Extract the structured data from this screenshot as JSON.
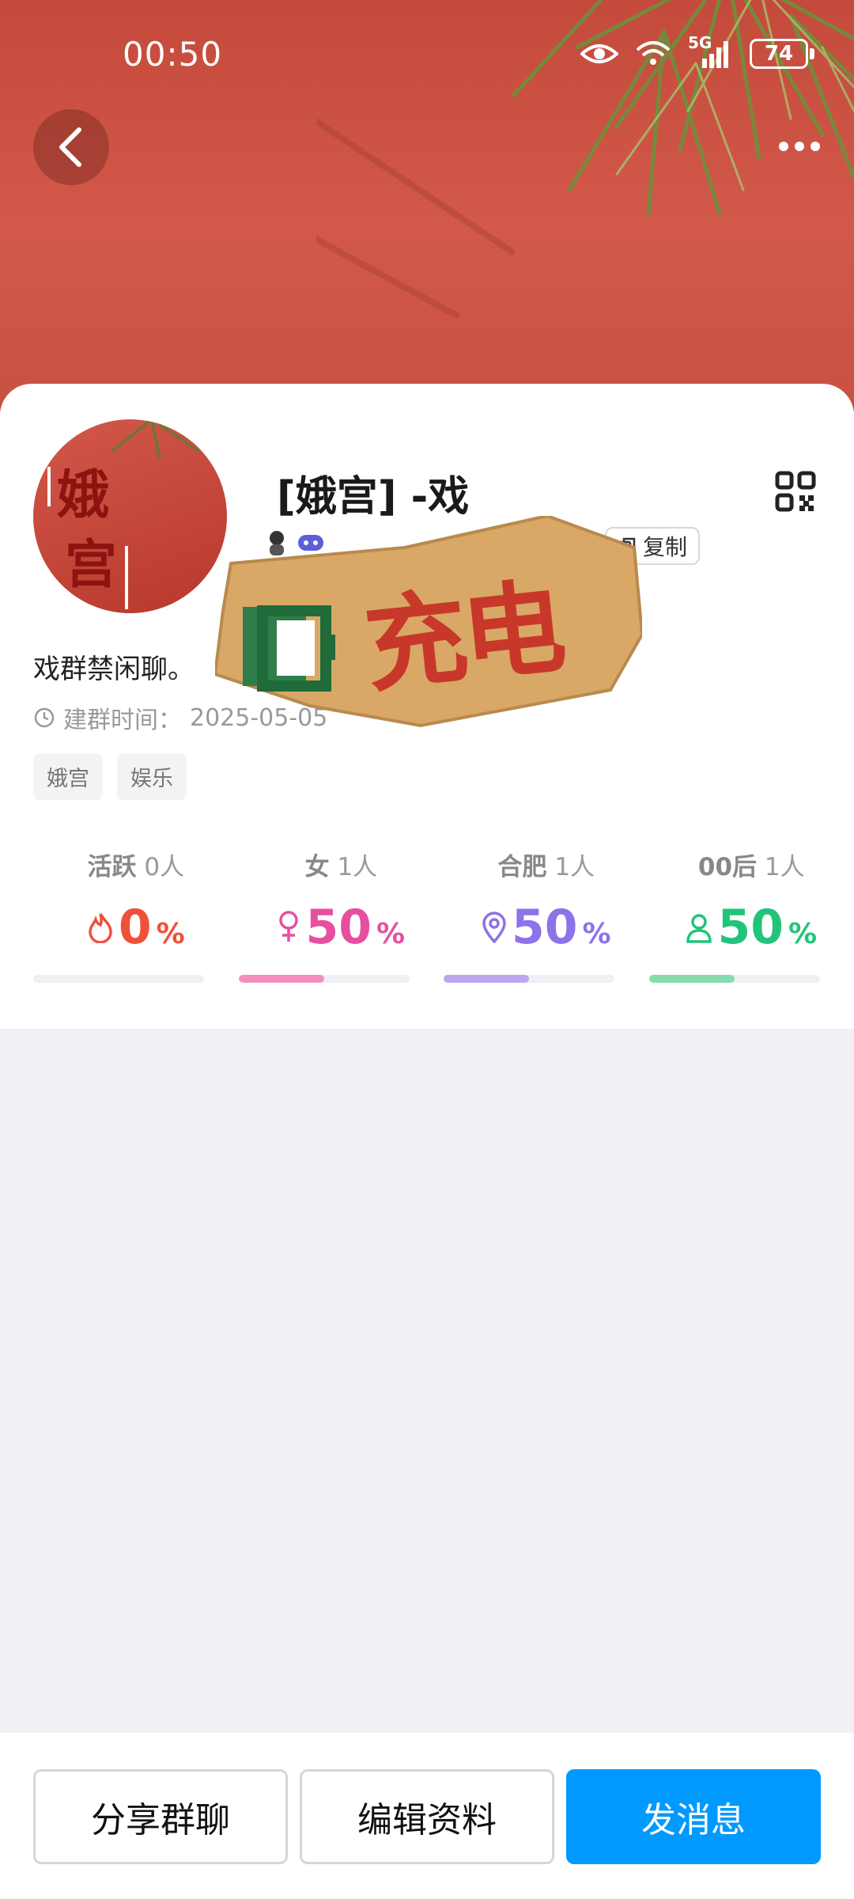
{
  "status_bar": {
    "time": "00:50",
    "battery": "74",
    "network": "5G"
  },
  "header": {
    "back_icon": "chevron-left-icon",
    "more_icon": "more-horizontal-icon"
  },
  "group": {
    "name": "[娥宫] -戏",
    "avatar_text": [
      "娥",
      "宫"
    ],
    "copy_label": "复制",
    "description": "戏群禁闲聊。",
    "created_label": "建群时间：",
    "created_date": "2025-05-05",
    "tags": [
      "娥宫",
      "娱乐"
    ]
  },
  "sticker": {
    "text": "充电"
  },
  "stats": [
    {
      "label": "活跃",
      "count": "0人",
      "value": "0",
      "unit": "%",
      "color": "#f0503a",
      "icon": "flame-icon",
      "fill": 0
    },
    {
      "label": "女",
      "count": "1人",
      "value": "50",
      "unit": "%",
      "color": "#e64fa0",
      "icon": "female-icon",
      "fill": 0.5
    },
    {
      "label": "合肥",
      "count": "1人",
      "value": "50",
      "unit": "%",
      "color": "#8d72e8",
      "icon": "location-pin-icon",
      "fill": 0.5
    },
    {
      "label": "00后",
      "count": "1人",
      "value": "50",
      "unit": "%",
      "color": "#22c47a",
      "icon": "person-icon",
      "fill": 0.5
    }
  ],
  "bar_colors": [
    "#f28fbf",
    "#b9a8f0",
    "#86dcae"
  ],
  "actions": {
    "share": "分享群聊",
    "edit": "编辑资料",
    "message": "发消息"
  }
}
